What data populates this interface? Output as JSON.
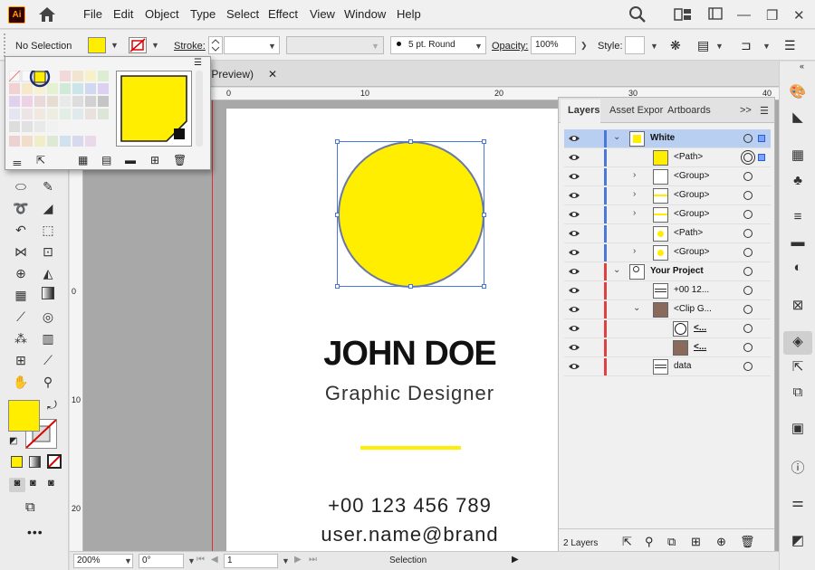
{
  "app": {
    "logo": "Ai"
  },
  "menu": [
    "File",
    "Edit",
    "Object",
    "Type",
    "Select",
    "Effect",
    "View",
    "Window",
    "Help"
  ],
  "window_controls": {
    "minimize": "—",
    "restore": "❒",
    "close": "✕"
  },
  "control_bar": {
    "selection_label": "No Selection",
    "stroke_label": "Stroke:",
    "stroke_value": "",
    "brush_label": "5 pt. Round",
    "opacity_label": "Opacity:",
    "opacity_value": "100%",
    "style_label": "Style:"
  },
  "document": {
    "tab_title": "/Preview)",
    "tab_close": "✕"
  },
  "ruler": {
    "h_ticks": [
      "0",
      "10",
      "20",
      "30",
      "40"
    ],
    "v_ticks": [
      "0",
      "10",
      "20"
    ]
  },
  "artboard": {
    "name": "JOHN DOE",
    "title": "Graphic Designer",
    "phone": "+00 123 456 789",
    "email": "user.name@brand"
  },
  "colors": {
    "accent_yellow": "#ffee00",
    "selection_blue": "#4a78d8",
    "layer_blue": "#4a78d8",
    "layer_red": "#e04040",
    "name_text": "#111111"
  },
  "status": {
    "zoom": "200%",
    "rotate": "0°",
    "artboard_num": "1",
    "tool": "Selection"
  },
  "layers_panel": {
    "tabs": [
      "Layers",
      "Asset Expor",
      "Artboards"
    ],
    "more": ">>",
    "rows": [
      {
        "name": "White",
        "depth": 0,
        "expand": "open",
        "bar": "blue",
        "thumb": "yellowsq",
        "selected": true
      },
      {
        "name": "<Path>",
        "depth": 1,
        "expand": "",
        "bar": "blue",
        "thumb": "yellowfill",
        "selected": false
      },
      {
        "name": "<Group>",
        "depth": 1,
        "expand": "closed",
        "bar": "blue",
        "thumb": "white",
        "selected": false
      },
      {
        "name": "<Group>",
        "depth": 1,
        "expand": "closed",
        "bar": "blue",
        "thumb": "line",
        "selected": false
      },
      {
        "name": "<Group>",
        "depth": 1,
        "expand": "closed",
        "bar": "blue",
        "thumb": "line",
        "selected": false
      },
      {
        "name": "<Path>",
        "depth": 1,
        "expand": "",
        "bar": "blue",
        "thumb": "yellowdot",
        "selected": false
      },
      {
        "name": "<Group>",
        "depth": 1,
        "expand": "closed",
        "bar": "blue",
        "thumb": "yellowdot",
        "selected": false
      },
      {
        "name": "Your Project",
        "depth": 0,
        "expand": "open",
        "bar": "red",
        "thumb": "doc",
        "selected": false
      },
      {
        "name": "+00 12...",
        "depth": 1,
        "expand": "",
        "bar": "red",
        "thumb": "text",
        "selected": false
      },
      {
        "name": "<Clip G...",
        "depth": 1,
        "expand": "open",
        "bar": "red",
        "thumb": "photo",
        "selected": false
      },
      {
        "name": "<...",
        "depth": 2,
        "expand": "",
        "bar": "red",
        "thumb": "circle",
        "selected": false
      },
      {
        "name": "<...",
        "depth": 2,
        "expand": "",
        "bar": "red",
        "thumb": "photo",
        "selected": false
      },
      {
        "name": "data",
        "depth": 1,
        "expand": "",
        "bar": "red",
        "thumb": "text",
        "selected": false
      }
    ],
    "footer_count": "2 Layers"
  }
}
